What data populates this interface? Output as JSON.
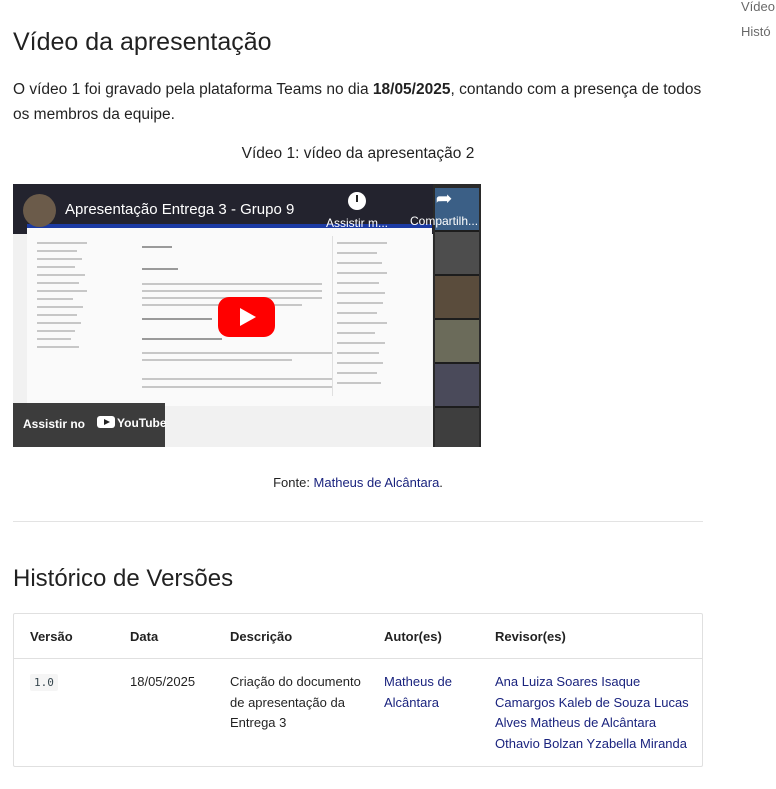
{
  "toc": {
    "items": [
      "Vídeo",
      "Histó"
    ]
  },
  "section_video": {
    "title": "Vídeo da apresentação",
    "intro_prefix": "O vídeo 1 foi gravado pela plataforma Teams no dia ",
    "intro_date": "18/05/2025",
    "intro_suffix": ", contando com a presença de todos os membros da equipe.",
    "caption": "Vídeo 1: vídeo da apresentação 2",
    "player": {
      "title": "Apresentação Entrega 3 - Grupo 9",
      "watch_later": "Assistir m...",
      "share": "Compartilh...",
      "watch_on": "Assistir no",
      "brand": "YouTube"
    },
    "source_prefix": "Fonte: ",
    "source_author": "Matheus de Alcântara",
    "source_suffix": "."
  },
  "section_history": {
    "title": "Histórico de Versões",
    "columns": [
      "Versão",
      "Data",
      "Descrição",
      "Autor(es)",
      "Revisor(es)"
    ],
    "rows": [
      {
        "version": "1.0",
        "date": "18/05/2025",
        "description": "Criação do documento de apresentação da Entrega 3",
        "author": "Matheus de Alcântara",
        "reviewers": [
          "Ana Luiza Soares Isaque",
          "Camargos Kaleb de Souza Lucas",
          "Alves Matheus de Alcântara",
          "Othavio Bolzan Yzabella Miranda"
        ]
      }
    ]
  },
  "colors": {
    "link": "#1a237e",
    "youtube_red": "#ff0000",
    "slide_header": "#1b3aa3"
  }
}
